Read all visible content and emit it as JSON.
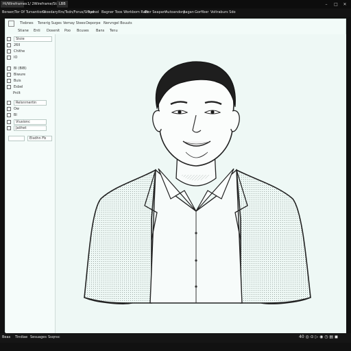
{
  "tabs": [
    {
      "label": "Hi/Wireframes"
    },
    {
      "label": "1/ 2Wireframe/Staire"
    },
    {
      "label": "LBB"
    }
  ],
  "window_controls": {
    "minimize": "–",
    "maximize": "□",
    "close": "✕"
  },
  "menu": [
    {
      "label": "Boraer/Tor Of Tursantions"
    },
    {
      "label": "Dioedary"
    },
    {
      "label": "Rrs/Tsdn/Forus/Sitner"
    },
    {
      "label": "Sydsol"
    },
    {
      "label": "Bagner Toos Workbom Rabr"
    },
    {
      "label": "Elor Seapart"
    },
    {
      "label": "Autoandory"
    },
    {
      "label": "Aagan"
    },
    {
      "label": "Gorfiber"
    },
    {
      "label": "Voltraburs Sdo"
    }
  ],
  "ribbon": {
    "top": [
      "Tlebnes",
      "Tonerig Suges",
      "Vemay Stees",
      "Oeporpe",
      "Nervngel Bouuts"
    ],
    "bottom": [
      "Stiane",
      "Enti",
      "Dosenit",
      "Poo",
      "Bcuses",
      "Bans",
      "Tenu"
    ]
  },
  "panel": {
    "rows": [
      {
        "label": "Stoie",
        "field": true
      },
      {
        "label": "26II",
        "field": false
      },
      {
        "label": "Chithe",
        "field": false
      },
      {
        "label": "IO",
        "field": false
      },
      {
        "label": "Bl (BIB)",
        "field": false
      },
      {
        "label": "Biwure",
        "field": false
      },
      {
        "label": "Buis",
        "field": false
      },
      {
        "label": "Esbel",
        "field": false
      },
      {
        "label": "Pnilt",
        "field": false
      },
      {
        "label": "Relsnrnertin",
        "field": true
      },
      {
        "label": "Ow",
        "field": false
      },
      {
        "label": "BI",
        "field": false
      },
      {
        "label": "Viusionc",
        "field": true
      },
      {
        "label": "Jaiihet",
        "field": true
      }
    ],
    "bottom_field": "Eisdhn Fb"
  },
  "status": {
    "items": [
      "Beas",
      "Tindiae",
      "Sesuages",
      "Ssqnsc"
    ],
    "right": "40 ◎ ⊙ ▷ ◉ ◷ ▤ ◼"
  }
}
